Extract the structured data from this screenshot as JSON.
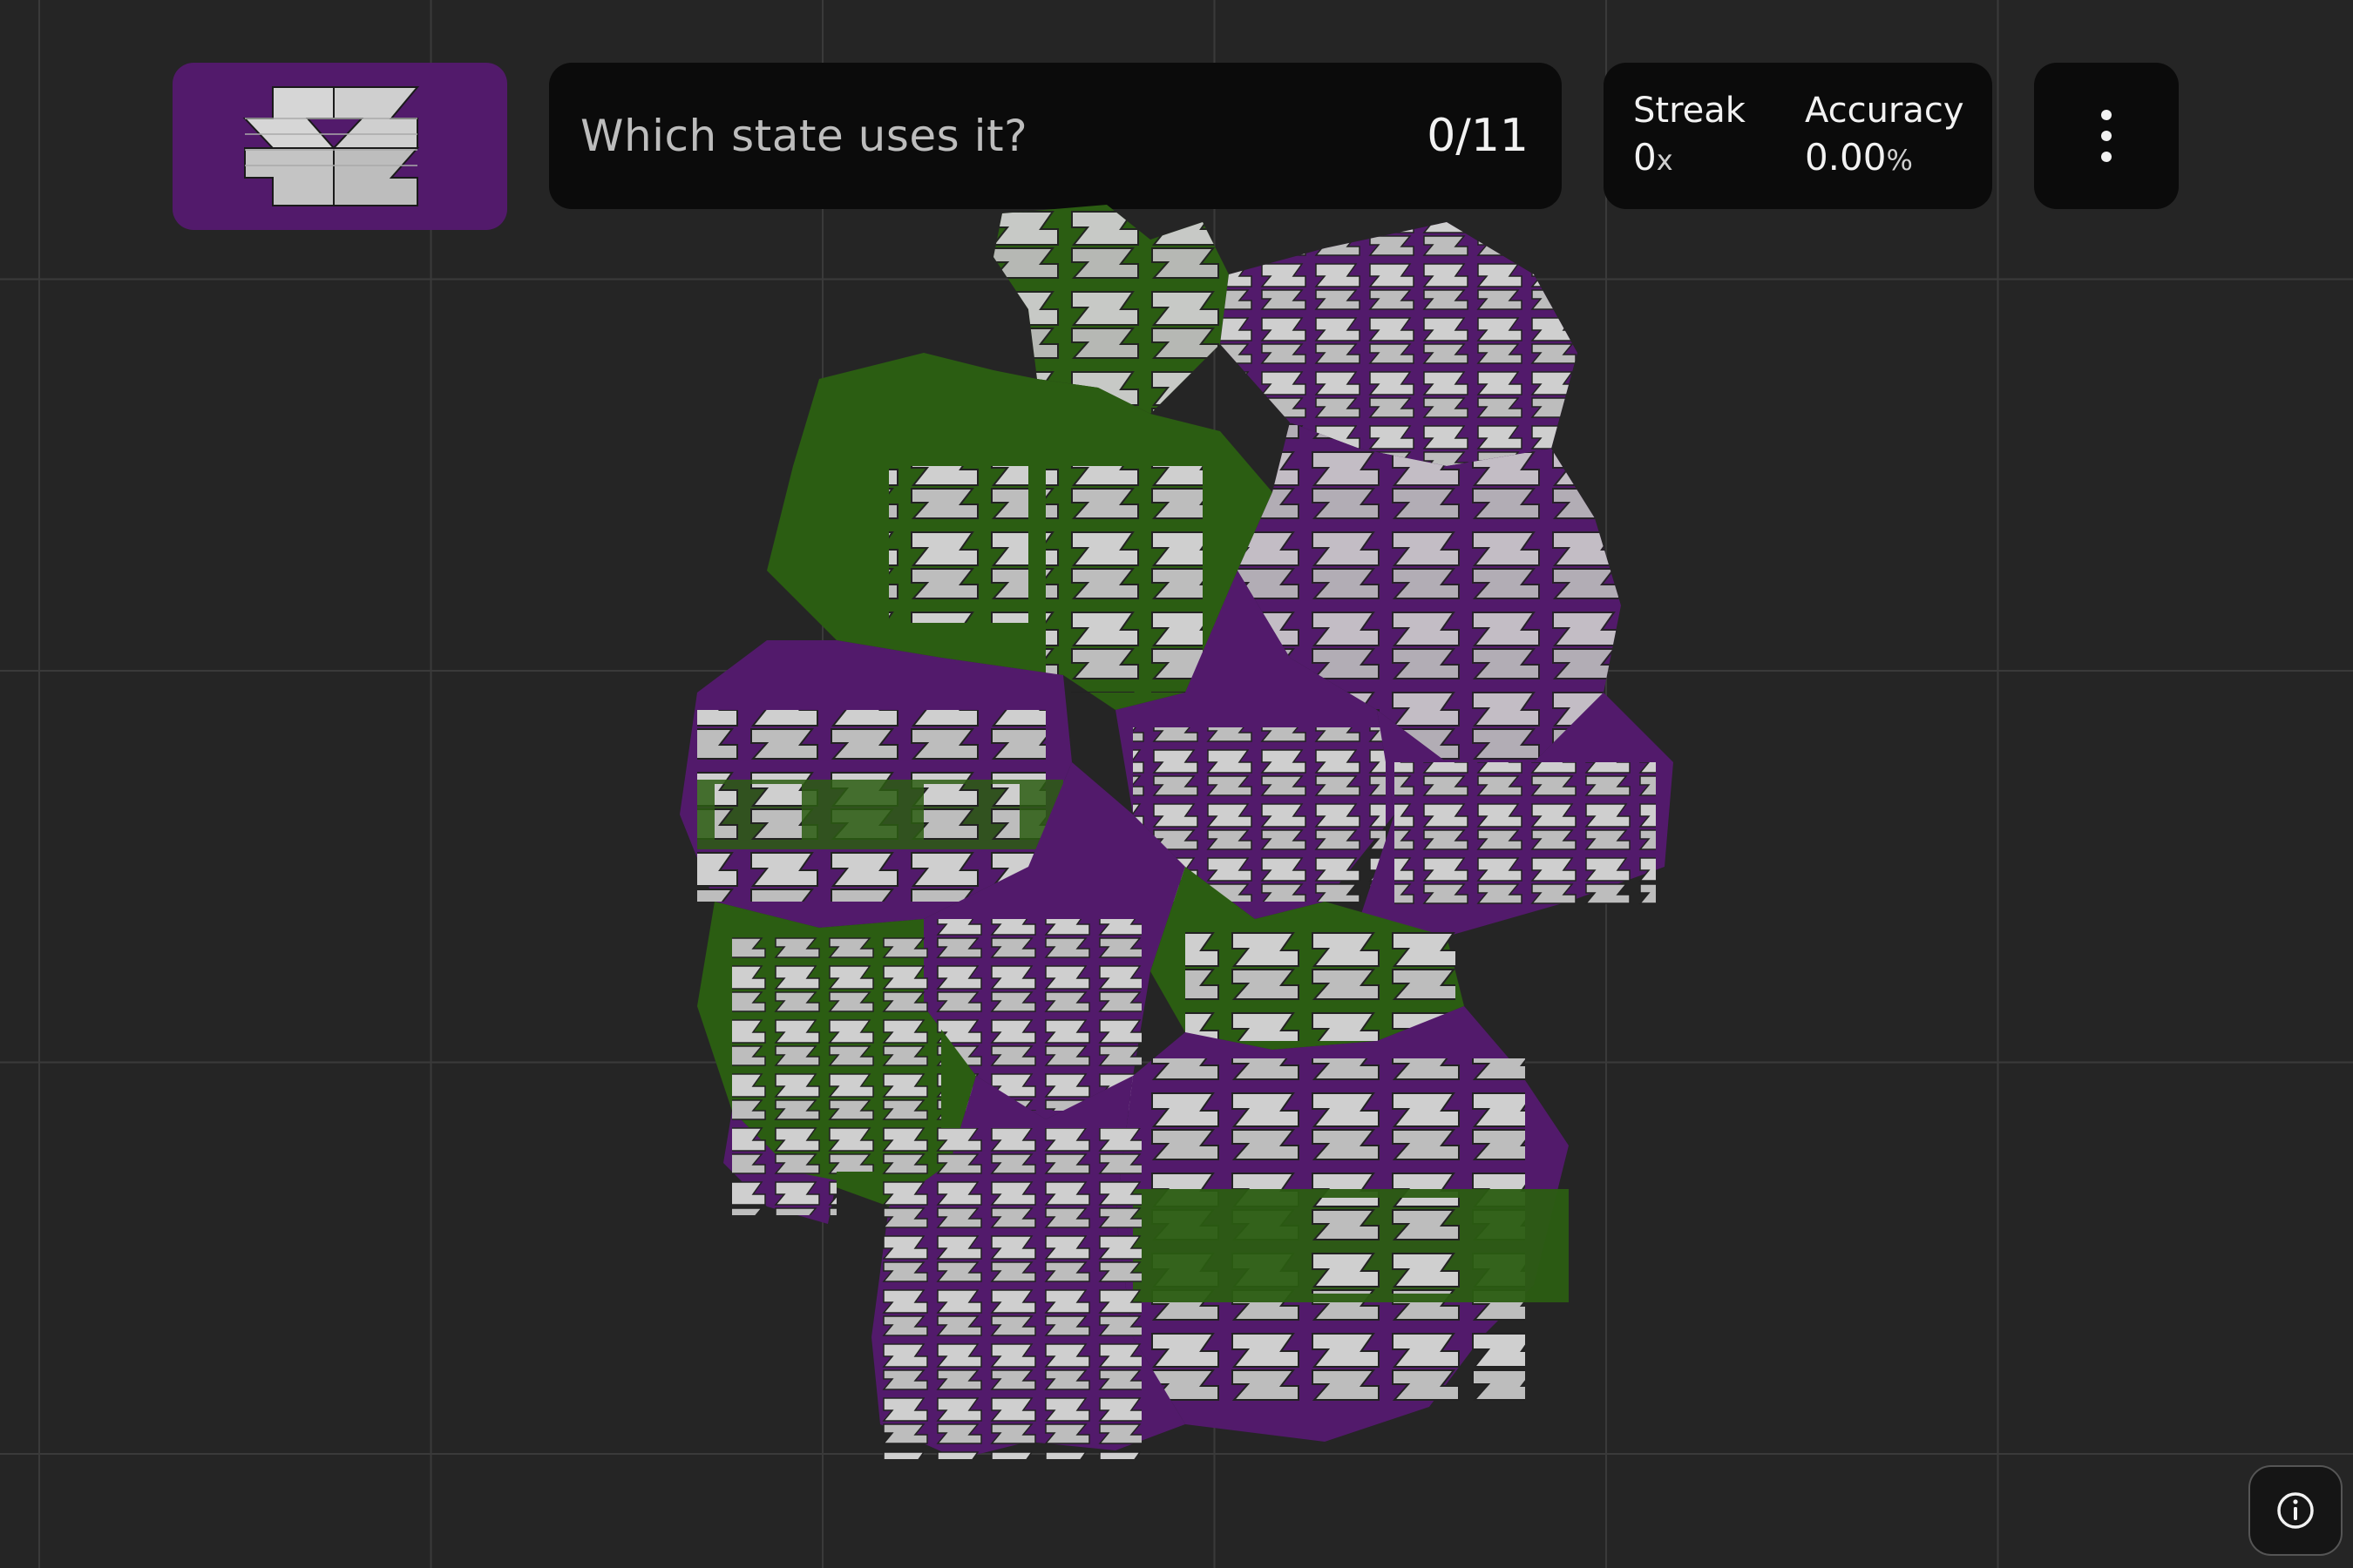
{
  "question": {
    "text": "Which state uses it?",
    "progress": "0/11",
    "correct": 0,
    "total": 11
  },
  "stats": {
    "streak_label": "Streak",
    "streak_value": "0",
    "streak_unit": "x",
    "accuracy_label": "Accuracy",
    "accuracy_value": "0.00",
    "accuracy_unit": "%"
  },
  "flag": {
    "background": "#521a6b",
    "pattern_color": "#cfcfcf"
  },
  "map": {
    "colors": {
      "green": "#2b5d12",
      "purple": "#521a6b",
      "tile": "#cfcfcf"
    }
  },
  "icons": {
    "menu": "more-vertical-icon",
    "info": "info-icon"
  }
}
